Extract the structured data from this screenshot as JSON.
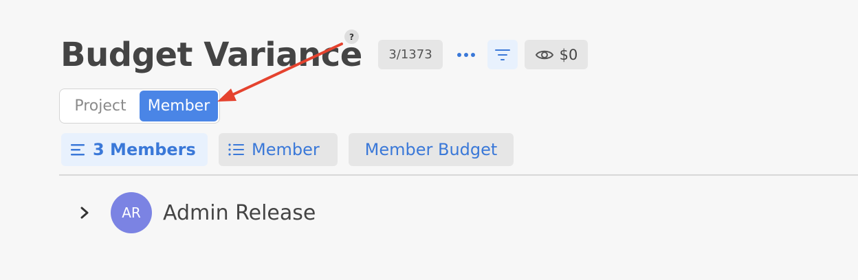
{
  "header": {
    "title": "Budget Variance",
    "help_label": "?",
    "count_badge": "3/1373",
    "visibility_value": "$0"
  },
  "view_toggle": {
    "options": [
      {
        "label": "Project",
        "active": false
      },
      {
        "label": "Member",
        "active": true
      }
    ]
  },
  "chips": {
    "members_label": "3 Members",
    "member_label": "Member",
    "member_budget_label": "Member Budget"
  },
  "rows": [
    {
      "initials": "AR",
      "name": "Admin Release"
    }
  ],
  "colors": {
    "accent": "#4a85e6",
    "accent_text": "#3a78d8",
    "avatar": "#7b83e3",
    "annotation_arrow": "#e5432f"
  },
  "icons": {
    "more": "more-horizontal-icon",
    "filter": "filter-icon",
    "visibility": "eye-icon",
    "members_chip": "lines-icon",
    "member_chip": "list-icon",
    "expand": "chevron-right-icon"
  }
}
